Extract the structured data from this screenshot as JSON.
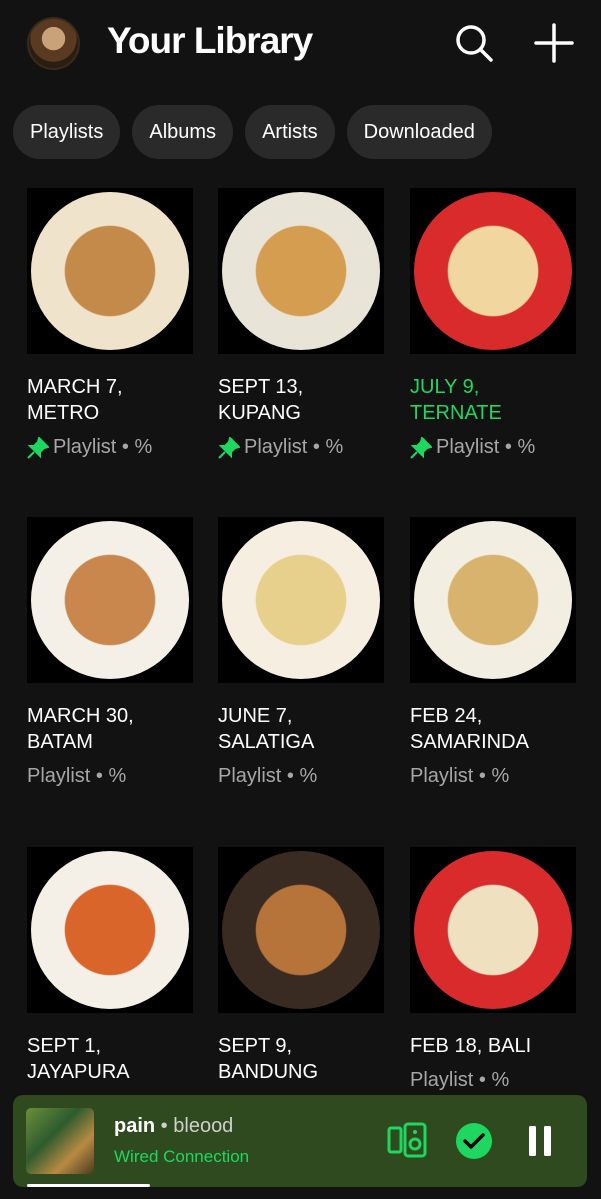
{
  "header": {
    "title": "Your Library",
    "avatar_icon": "user-avatar",
    "search_icon": "search-icon",
    "add_icon": "plus-icon"
  },
  "filters": [
    "Playlists",
    "Albums",
    "Artists",
    "Downloaded"
  ],
  "grid": [
    {
      "title_l1": "MARCH 7,",
      "title_l2": "METRO",
      "pinned": true,
      "highlight": false,
      "meta": "Playlist • %"
    },
    {
      "title_l1": "SEPT 13,",
      "title_l2": "KUPANG",
      "pinned": true,
      "highlight": false,
      "meta": "Playlist • %"
    },
    {
      "title_l1": "JULY 9,",
      "title_l2": "TERNATE",
      "pinned": true,
      "highlight": true,
      "meta": "Playlist • %"
    },
    {
      "title_l1": "MARCH 30,",
      "title_l2": "BATAM",
      "pinned": false,
      "highlight": false,
      "meta": "Playlist • %"
    },
    {
      "title_l1": "JUNE 7,",
      "title_l2": "SALATIGA",
      "pinned": false,
      "highlight": false,
      "meta": "Playlist • %"
    },
    {
      "title_l1": "FEB 24,",
      "title_l2": "SAMARINDA",
      "pinned": false,
      "highlight": false,
      "meta": "Playlist • %"
    },
    {
      "title_l1": "SEPT 1,",
      "title_l2": "JAYAPURA",
      "pinned": false,
      "highlight": false,
      "meta": ""
    },
    {
      "title_l1": "SEPT 9,",
      "title_l2": "BANDUNG",
      "pinned": false,
      "highlight": false,
      "meta": ""
    },
    {
      "title_l1": "FEB 18, BALI",
      "title_l2": "",
      "pinned": false,
      "highlight": false,
      "meta": "Playlist • %"
    }
  ],
  "player": {
    "track": "pain",
    "separator": " • ",
    "artist": "bleood",
    "device": "Wired Connection",
    "progress": 0.22,
    "icons": [
      "connect-device-icon",
      "saved-check-icon",
      "pause-icon"
    ]
  },
  "colors": {
    "background": "#121212",
    "chip": "#2a2a2a",
    "accent": "#1ed760",
    "player": "#2f4a1e",
    "muted": "#a7a7a7"
  }
}
